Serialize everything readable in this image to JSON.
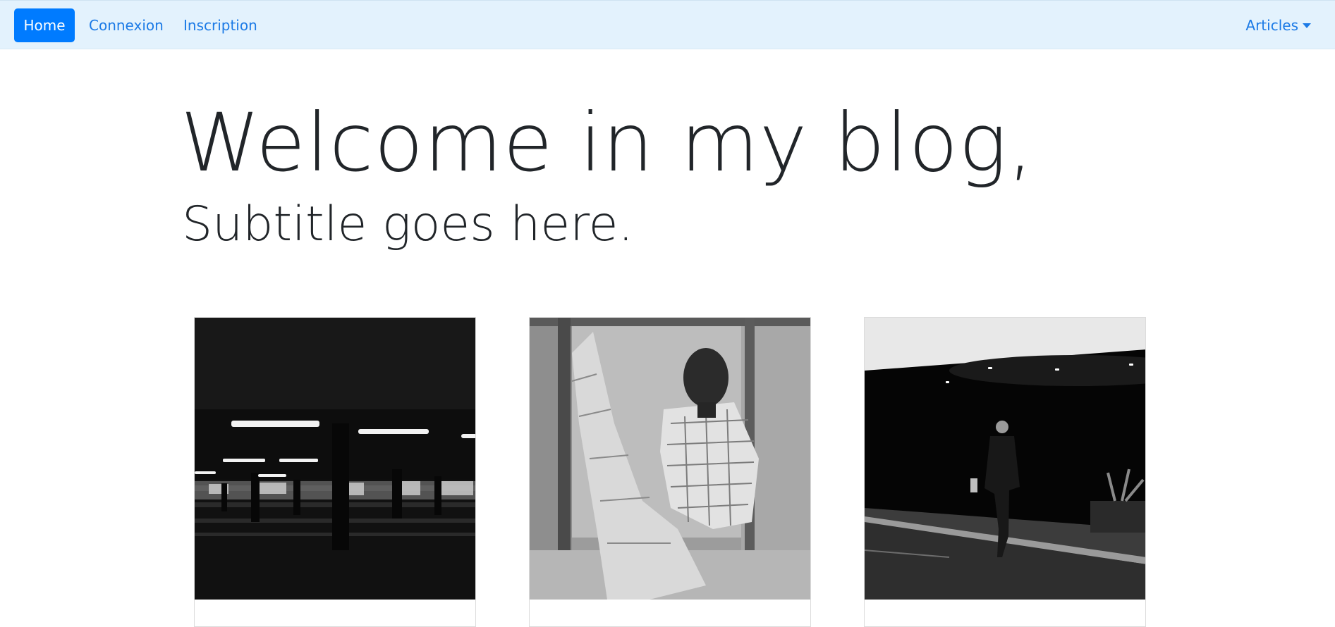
{
  "navbar": {
    "home_label": "Home",
    "connexion_label": "Connexion",
    "inscription_label": "Inscription",
    "articles_label": "Articles",
    "articles_icon": "caret-down-icon",
    "active_color": "#007bff",
    "background_color": "#e3f2fd",
    "link_color": "#1b7ae6"
  },
  "hero": {
    "title": "Welcome in my blog,",
    "subtitle": "Subtitle goes here."
  },
  "cards": [
    {
      "image_subject": "dark parking garage with ceiling lights"
    },
    {
      "image_subject": "young man in checkered shirt sitting in a doorway"
    },
    {
      "image_subject": "man in suit walking under a dark overhang"
    }
  ]
}
